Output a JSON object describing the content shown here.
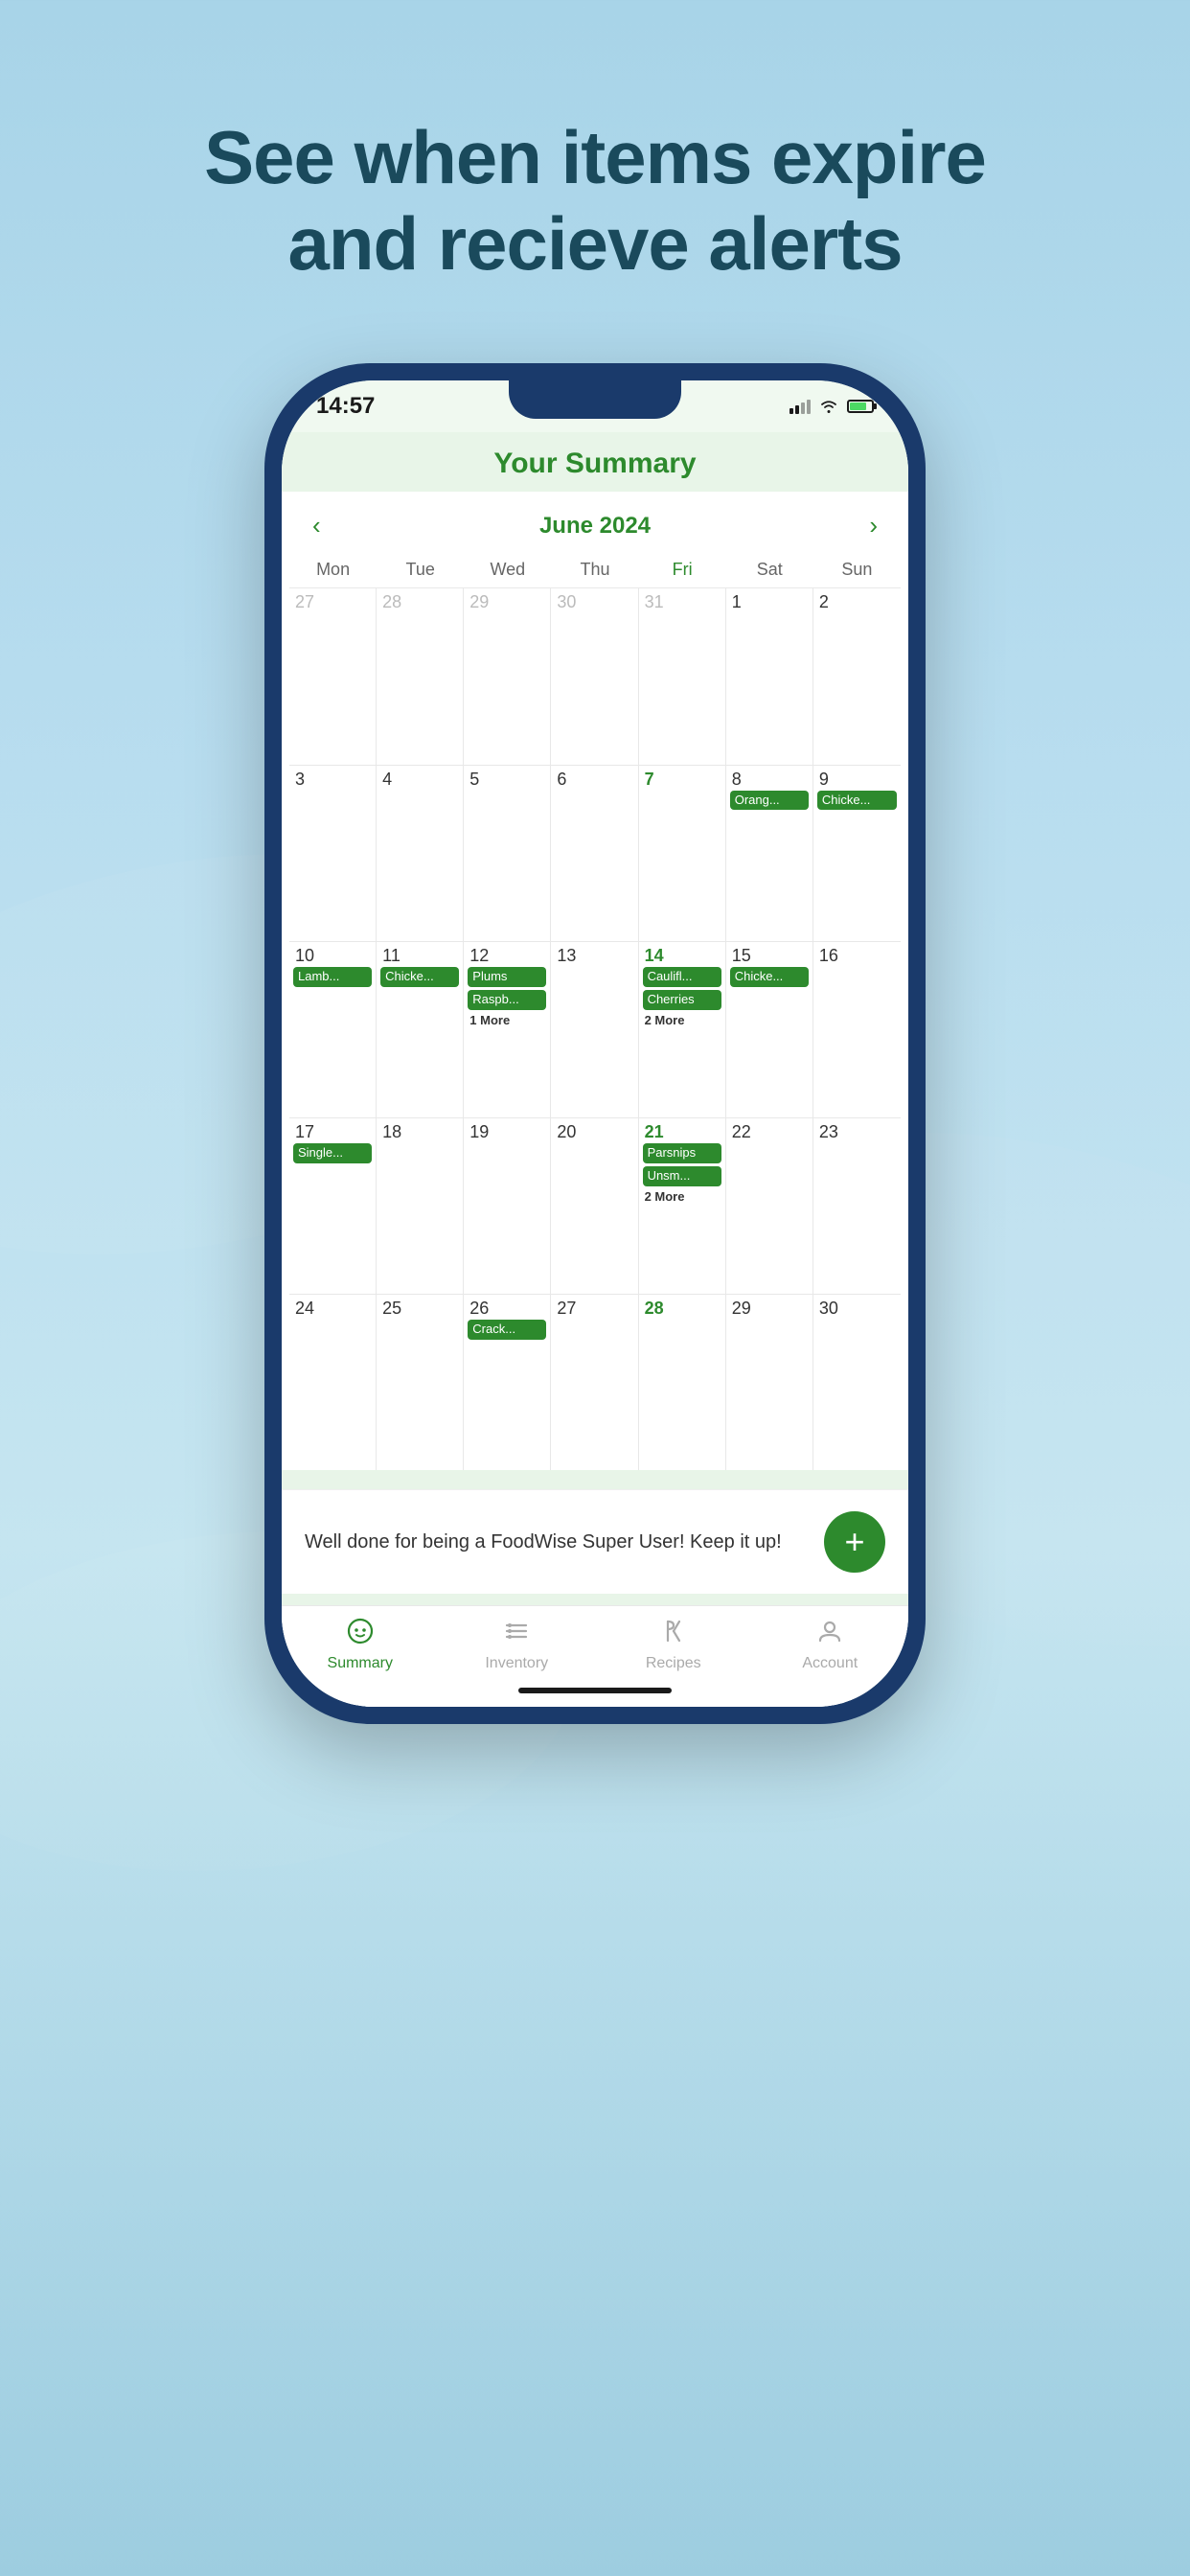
{
  "page": {
    "background_color": "#a8d4e8",
    "headline": "See when items expire\nand recieve alerts"
  },
  "status_bar": {
    "time": "14:57",
    "signal_bars": [
      6,
      9,
      12,
      15
    ],
    "wifi": "wifi",
    "battery_percent": 75
  },
  "app": {
    "title": "Your Summary",
    "calendar": {
      "month_label": "June 2024",
      "prev_button": "‹",
      "next_button": "›",
      "day_headers": [
        "Mon",
        "Tue",
        "Wed",
        "Thu",
        "Fri",
        "Sat",
        "Sun"
      ],
      "weeks": [
        {
          "days": [
            {
              "date": "27",
              "other_month": true,
              "events": []
            },
            {
              "date": "28",
              "other_month": true,
              "events": []
            },
            {
              "date": "29",
              "other_month": true,
              "events": []
            },
            {
              "date": "30",
              "other_month": true,
              "events": []
            },
            {
              "date": "31",
              "other_month": true,
              "friday": true,
              "events": []
            },
            {
              "date": "1",
              "events": []
            },
            {
              "date": "2",
              "events": []
            }
          ]
        },
        {
          "days": [
            {
              "date": "3",
              "events": []
            },
            {
              "date": "4",
              "events": []
            },
            {
              "date": "5",
              "events": []
            },
            {
              "date": "6",
              "events": []
            },
            {
              "date": "7",
              "friday": true,
              "events": []
            },
            {
              "date": "8",
              "events": [
                {
                  "label": "Orang..."
                }
              ]
            },
            {
              "date": "9",
              "events": [
                {
                  "label": "Chicke..."
                }
              ]
            }
          ]
        },
        {
          "days": [
            {
              "date": "10",
              "events": [
                {
                  "label": "Lamb..."
                }
              ]
            },
            {
              "date": "11",
              "events": [
                {
                  "label": "Chicke..."
                }
              ]
            },
            {
              "date": "12",
              "events": [
                {
                  "label": "Plums"
                },
                {
                  "label": "Raspb..."
                },
                {
                  "more": "1 More"
                }
              ]
            },
            {
              "date": "13",
              "events": []
            },
            {
              "date": "14",
              "friday": true,
              "events": [
                {
                  "label": "Caulifl..."
                },
                {
                  "label": "Cherries"
                },
                {
                  "more": "2 More"
                }
              ]
            },
            {
              "date": "15",
              "events": [
                {
                  "label": "Chicke..."
                }
              ]
            },
            {
              "date": "16",
              "events": []
            }
          ]
        },
        {
          "days": [
            {
              "date": "17",
              "events": [
                {
                  "label": "Single..."
                }
              ]
            },
            {
              "date": "18",
              "events": []
            },
            {
              "date": "19",
              "events": []
            },
            {
              "date": "20",
              "events": []
            },
            {
              "date": "21",
              "friday": true,
              "events": [
                {
                  "label": "Parsnips"
                },
                {
                  "label": "Unsm..."
                },
                {
                  "more": "2 More"
                }
              ]
            },
            {
              "date": "22",
              "events": []
            },
            {
              "date": "23",
              "events": []
            }
          ]
        },
        {
          "days": [
            {
              "date": "24",
              "events": []
            },
            {
              "date": "25",
              "events": []
            },
            {
              "date": "26",
              "events": [
                {
                  "label": "Crack..."
                }
              ]
            },
            {
              "date": "27",
              "events": []
            },
            {
              "date": "28",
              "friday": true,
              "events": []
            },
            {
              "date": "29",
              "events": []
            },
            {
              "date": "30",
              "events": []
            }
          ]
        }
      ]
    },
    "message": "Well done for being a FoodWise Super User! Keep it up!",
    "add_button_label": "+",
    "tab_bar": {
      "tabs": [
        {
          "id": "summary",
          "label": "Summary",
          "icon": "summary",
          "active": true
        },
        {
          "id": "inventory",
          "label": "Inventory",
          "icon": "inventory",
          "active": false
        },
        {
          "id": "recipes",
          "label": "Recipes",
          "icon": "recipes",
          "active": false
        },
        {
          "id": "account",
          "label": "Account",
          "icon": "account",
          "active": false
        }
      ]
    }
  }
}
